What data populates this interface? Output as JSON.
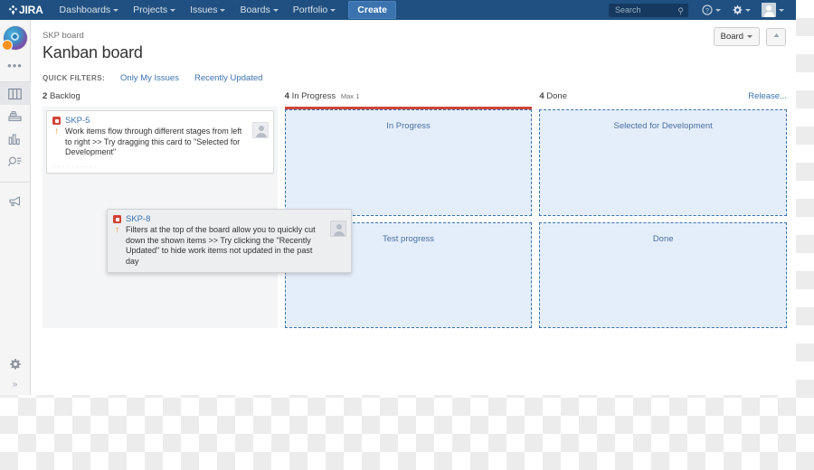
{
  "topnav": {
    "logo_text": "JIRA",
    "items": [
      {
        "label": "Dashboards",
        "has_caret": true
      },
      {
        "label": "Projects",
        "has_caret": true
      },
      {
        "label": "Issues",
        "has_caret": true
      },
      {
        "label": "Boards",
        "has_caret": true
      },
      {
        "label": "Portfolio",
        "has_caret": true
      }
    ],
    "create_label": "Create",
    "search_placeholder": "Search",
    "search_value": "",
    "help_icon": "question-circle-icon",
    "settings_icon": "gear-icon",
    "profile_icon": "avatar-icon"
  },
  "sidebar": {
    "project_avatar": "project-avatar-icon",
    "more_label": "•••",
    "items": [
      {
        "icon": "board-columns-icon",
        "name": "board",
        "active": true
      },
      {
        "icon": "backlog-icon",
        "name": "backlog",
        "active": false
      },
      {
        "icon": "reports-chart-icon",
        "name": "reports",
        "active": false
      },
      {
        "icon": "issues-search-icon",
        "name": "issues",
        "active": false
      },
      {
        "icon": "megaphone-icon",
        "name": "announcements",
        "active": false
      }
    ],
    "bottom_items": [
      {
        "icon": "gear-icon",
        "name": "project-settings"
      }
    ],
    "expand_label": "»"
  },
  "header": {
    "breadcrumb": "SKP board",
    "title": "Kanban board",
    "quick_filters_label": "QUICK FILTERS:",
    "quick_filters": [
      {
        "label": "Only My Issues"
      },
      {
        "label": "Recently Updated"
      }
    ],
    "board_button": "Board",
    "collapse_button_icon": "collapse-icon"
  },
  "board": {
    "columns": [
      {
        "count": "2",
        "name": "Backlog",
        "max": "",
        "type": "cards"
      },
      {
        "count": "4",
        "name": "In Progress",
        "max": "Max 1",
        "type": "dropzones",
        "wip_exceeded": true
      },
      {
        "count": "4",
        "name": "Done",
        "max": "",
        "type": "dropzones",
        "wip_exceeded": false,
        "release_link": "Release..."
      }
    ],
    "cards": [
      {
        "key": "SKP-5",
        "type_icon": "bug-icon",
        "priority_icon": "priority-major-up-arrow",
        "summary": "Work items flow through different stages from left to right >> Try dragging this card to \"Selected for Development\"",
        "avatar": "assignee-avatar"
      }
    ],
    "dragging_card": {
      "key": "SKP-8",
      "type_icon": "bug-icon",
      "priority_icon": "priority-major-up-arrow",
      "summary": "Filters at the top of the board allow you to quickly cut down the shown items >> Try clicking the \"Recently Updated\" to hide work items not updated in the past day",
      "avatar": "assignee-avatar"
    },
    "dropzones": [
      {
        "label": "In Progress",
        "column": "In Progress",
        "row": 1
      },
      {
        "label": "Selected for Development",
        "column": "Done",
        "row": 1
      },
      {
        "label": "Test progress",
        "column": "In Progress",
        "row": 2
      },
      {
        "label": "Done",
        "column": "Done",
        "row": 2
      }
    ]
  },
  "colors": {
    "nav_blue": "#205081",
    "link_blue": "#3b73af",
    "wip_red": "#d04437",
    "priority_orange": "#f79232",
    "dropzone_fill": "#e4eefa",
    "backlog_bg": "#f4f5f7"
  }
}
